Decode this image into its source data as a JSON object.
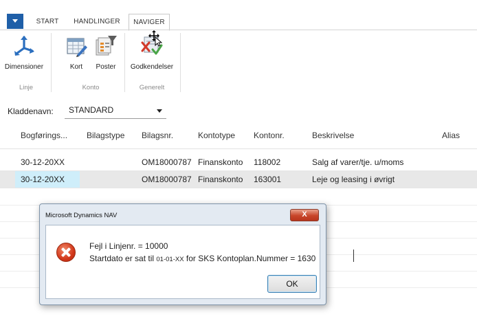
{
  "ribbon": {
    "tabs": [
      "START",
      "HANDLINGER",
      "NAVIGER"
    ],
    "active_tab": "NAVIGER",
    "buttons": {
      "dimensioner": "Dimensioner",
      "kort": "Kort",
      "poster": "Poster",
      "godkendelser": "Godkendelser"
    },
    "groups": {
      "linje": "Linje",
      "konto": "Konto",
      "generelt": "Generelt"
    }
  },
  "journal": {
    "label": "Kladdenavn:",
    "value": "STANDARD"
  },
  "grid": {
    "headers": {
      "bogforing": "Bogførings...",
      "bilagstype": "Bilagstype",
      "bilagsnr": "Bilagsnr.",
      "kontotype": "Kontotype",
      "kontonr": "Kontonr.",
      "beskrivelse": "Beskrivelse",
      "alias": "Alias"
    },
    "rows": [
      {
        "date": "30-12-20XX",
        "bilagsnr": "OM18000787",
        "kontotype": "Finanskonto",
        "kontonr": "118002",
        "beskrivelse": "Salg af varer/tje. u/moms"
      },
      {
        "date": "30-12-20XX",
        "bilagsnr": "OM18000787",
        "kontotype": "Finanskonto",
        "kontonr": "163001",
        "beskrivelse": "Leje og leasing i øvrigt"
      }
    ]
  },
  "dialog": {
    "title": "Microsoft Dynamics NAV",
    "close_label": "X",
    "line1": "Fejl i Linjenr. = 10000",
    "line2_a": "Startdato er sat til",
    "line2_date": "01-01-XX",
    "line2_b": "for SKS Kontoplan.Nummer = 1630",
    "ok_label": "OK"
  },
  "colors": {
    "accent_blue": "#1f5fa8",
    "selected_cell": "#cfeefa",
    "selected_row": "#e8e8e8",
    "error_red": "#d2371a"
  }
}
